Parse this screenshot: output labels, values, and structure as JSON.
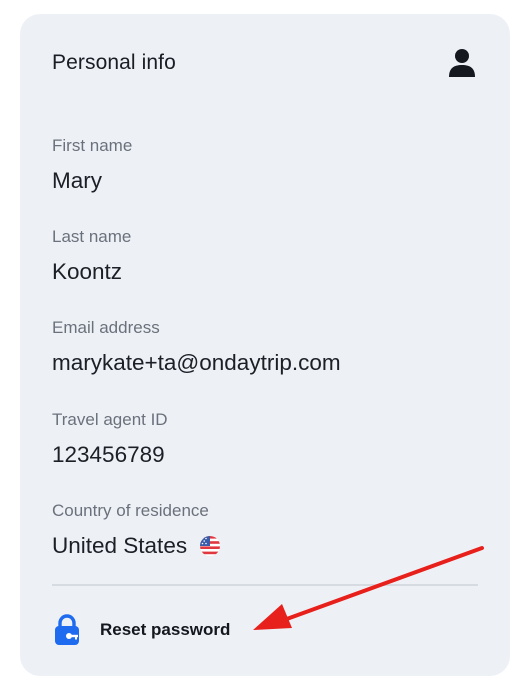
{
  "card": {
    "title": "Personal info",
    "profile_icon": "user-icon"
  },
  "fields": [
    {
      "label": "First name",
      "value": "Mary"
    },
    {
      "label": "Last name",
      "value": "Koontz"
    },
    {
      "label": "Email address",
      "value": "marykate+ta@ondaytrip.com"
    },
    {
      "label": "Travel agent ID",
      "value": "123456789"
    },
    {
      "label": "Country of residence",
      "value": "United States",
      "flag_icon": "us-flag-icon"
    }
  ],
  "reset": {
    "label": "Reset password",
    "icon": "lock-key-icon",
    "icon_color": "#1e6bf0"
  },
  "annotation": {
    "arrow_color": "#e8201c"
  }
}
